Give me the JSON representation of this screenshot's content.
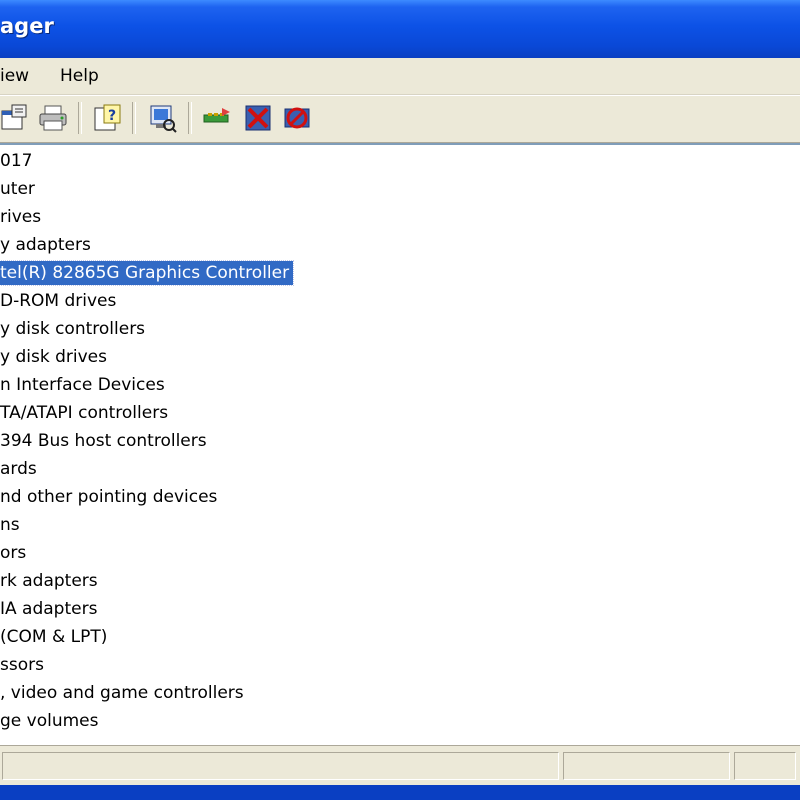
{
  "window": {
    "title": "ager"
  },
  "menu": [
    {
      "label": "iew",
      "x": 0
    },
    {
      "label": "Help",
      "x": 60
    }
  ],
  "toolbar": {
    "buttons": [
      {
        "name": "properties-icon"
      },
      {
        "name": "print-icon"
      },
      {
        "name": "help-icon"
      },
      {
        "name": "scan-hardware-icon"
      },
      {
        "name": "update-driver-icon"
      },
      {
        "name": "disable-device-icon"
      },
      {
        "name": "uninstall-device-icon"
      }
    ]
  },
  "tree": {
    "rows": [
      {
        "label": "017",
        "selected": false
      },
      {
        "label": "uter",
        "selected": false
      },
      {
        "label": "rives",
        "selected": false
      },
      {
        "label": "y adapters",
        "selected": false
      },
      {
        "label": "tel(R) 82865G Graphics Controller",
        "selected": true
      },
      {
        "label": "D-ROM drives",
        "selected": false
      },
      {
        "label": "y disk controllers",
        "selected": false
      },
      {
        "label": "y disk drives",
        "selected": false
      },
      {
        "label": "n Interface Devices",
        "selected": false
      },
      {
        "label": "TA/ATAPI controllers",
        "selected": false
      },
      {
        "label": "394 Bus host controllers",
        "selected": false
      },
      {
        "label": "ards",
        "selected": false
      },
      {
        "label": "nd other pointing devices",
        "selected": false
      },
      {
        "label": "ns",
        "selected": false
      },
      {
        "label": "ors",
        "selected": false
      },
      {
        "label": "rk adapters",
        "selected": false
      },
      {
        "label": "IA adapters",
        "selected": false
      },
      {
        "label": "(COM & LPT)",
        "selected": false
      },
      {
        "label": "ssors",
        "selected": false
      },
      {
        "label": ", video and game controllers",
        "selected": false
      },
      {
        "label": "ge volumes",
        "selected": false
      }
    ]
  },
  "colors": {
    "titlebar": "#0a48d6",
    "selection": "#316ac5",
    "chrome": "#ece9d8"
  }
}
